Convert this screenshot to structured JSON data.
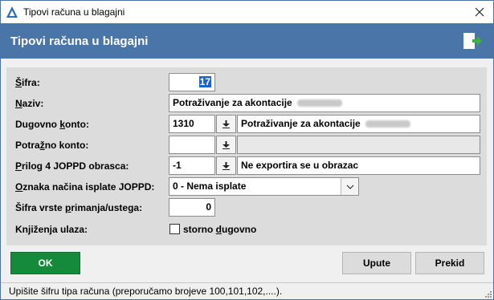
{
  "window": {
    "title": "Tipovi računa u blagajni"
  },
  "header": {
    "title": "Tipovi računa u blagajni"
  },
  "colors": {
    "header_bg": "#4a75a8",
    "ok_button": "#158a3a",
    "exit_arrow": "#3cb043"
  },
  "icons": {
    "app": "app-logo-icon",
    "close": "close-icon",
    "exit": "exit-door-icon",
    "download": "download-arrow-icon",
    "combo": "chevron-down-icon",
    "grip": "resize-grip-icon"
  },
  "form": {
    "sifra": {
      "label_u": "Š",
      "label_rest": "ifra:",
      "value": "17"
    },
    "naziv": {
      "label_u": "N",
      "label_rest": "aziv:",
      "value": "Potraživanje za akontacije"
    },
    "dugovno": {
      "label_pre": "Dugovno ",
      "label_u": "k",
      "label_rest": "onto:",
      "code": "1310",
      "name": "Potraživanje za akontacije"
    },
    "potrazno": {
      "label_pre": "Potra",
      "label_u": "ž",
      "label_rest": "no konto:",
      "code": "",
      "name": ""
    },
    "prilog": {
      "label_u": "P",
      "label_rest": "rilog 4 JOPPD obrasca:",
      "code": "-1",
      "name": "Ne exportira se u obrazac"
    },
    "oznaka": {
      "label_u": "O",
      "label_rest": "znaka načina isplate JOPPD:",
      "value": "0 - Nema isplate"
    },
    "sifra_vrste": {
      "label_pre": "Šifra vrste ",
      "label_u": "p",
      "label_rest": "rimanja/ustega:",
      "value": "0"
    },
    "knjizenja": {
      "label": "Knjiženja ulaza:",
      "checkbox_pre": "storno ",
      "checkbox_u": "d",
      "checkbox_rest": "ugovno",
      "checked": false
    }
  },
  "buttons": {
    "ok": "OK",
    "upute": "Upute",
    "prekid": "Prekid"
  },
  "status": {
    "text": "Upišite šifru tipa računa (preporučamo brojeve 100,101,102,....)."
  }
}
